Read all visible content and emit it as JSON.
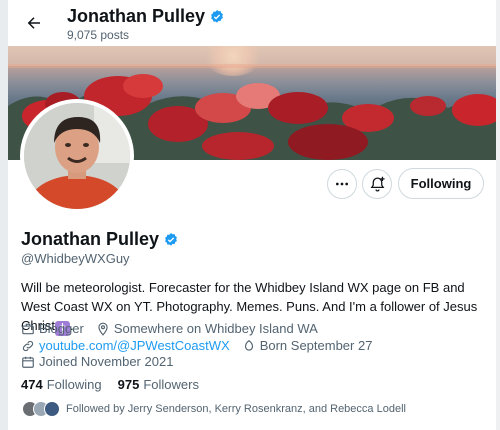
{
  "header": {
    "name": "Jonathan Pulley",
    "posts": "9,075 posts"
  },
  "actions": {
    "following_label": "Following"
  },
  "profile": {
    "name": "Jonathan Pulley",
    "handle": "@WhidbeyWXGuy",
    "bio": "Will be meteorologist. Forecaster for the Whidbey Island WX page on FB and West Coast WX on YT. Photography. Memes. Puns. And I'm a follower of Jesus Christ",
    "bio_emoji": "†",
    "category": "Blogger",
    "location": "Somewhere on Whidbey Island WA",
    "website": "youtube.com/@JPWestCoastWX",
    "born": "Born September 27",
    "joined": "Joined November 2021"
  },
  "stats": {
    "following_count": "474",
    "following_label": "Following",
    "followers_count": "975",
    "followers_label": "Followers"
  },
  "followed_by": "Followed by Jerry Senderson, Kerry Rosenkranz, and Rebecca Lodell",
  "colors": {
    "accent": "#1d9bf0",
    "text": "#0f1419",
    "muted": "#536471"
  },
  "icons": [
    "back-arrow-icon",
    "verified-badge-icon",
    "more-icon",
    "bell-plus-icon",
    "briefcase-icon",
    "location-icon",
    "link-icon",
    "birthday-icon",
    "calendar-icon"
  ]
}
